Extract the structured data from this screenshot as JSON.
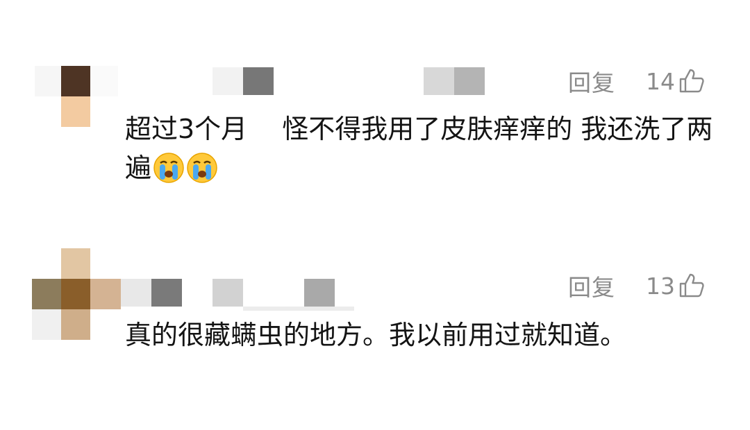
{
  "comments": [
    {
      "text": "超过3个月　 怪不得我用了皮肤痒痒的 我还洗了两遍",
      "emoji": [
        "crying-face",
        "crying-face"
      ],
      "reply_label": "回复",
      "likes": "14"
    },
    {
      "text": "真的很藏螨虫的地方。我以前用过就知道。",
      "emoji": [],
      "reply_label": "回复",
      "likes": "13"
    }
  ],
  "colors": {
    "text": "#141414",
    "meta": "#8a8a8a",
    "background": "#ffffff"
  }
}
